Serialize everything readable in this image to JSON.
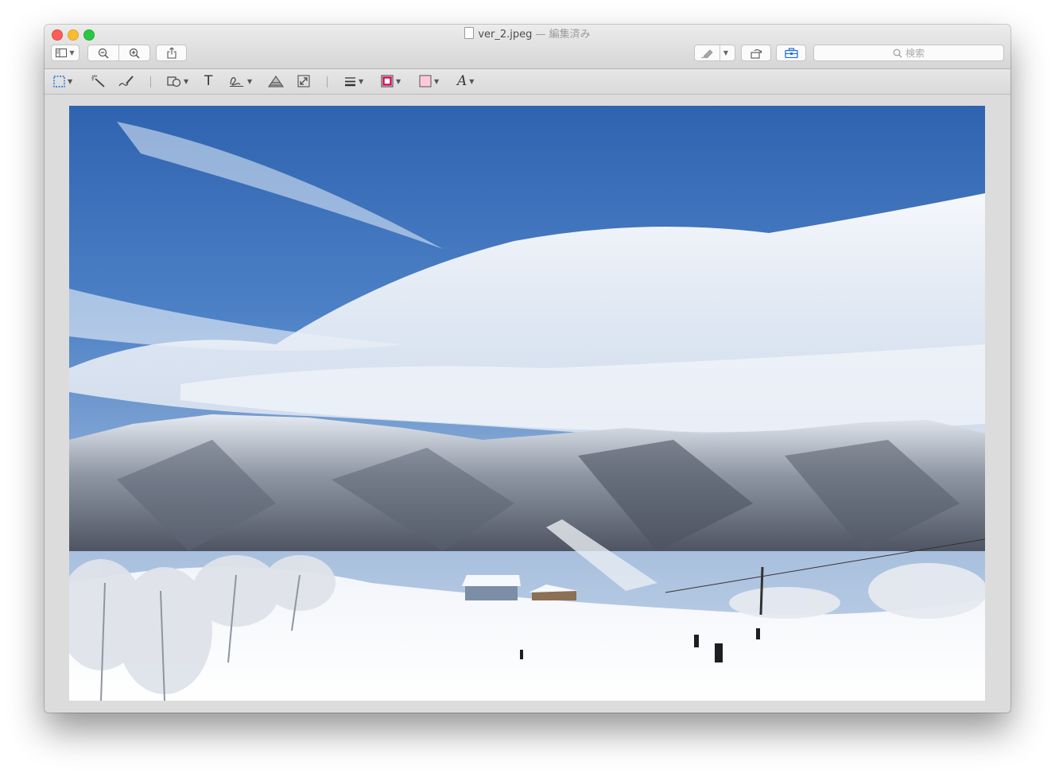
{
  "window": {
    "file_name": "ver_2.jpeg",
    "separator": "—",
    "edit_status": "編集済み"
  },
  "toolbar": {
    "sidebar_icon": "sidebar-icon",
    "zoom_out_icon": "zoom-out-icon",
    "zoom_in_icon": "zoom-in-icon",
    "share_icon": "share-icon",
    "highlight_icon": "highlighter-icon",
    "rotate_icon": "rotate-icon",
    "markup_icon": "toolbox-icon",
    "search_placeholder": "検索"
  },
  "markup_tools": [
    "rect-selection-icon",
    "instant-alpha-icon",
    "sketch-icon",
    "shapes-icon",
    "text-icon",
    "sign-icon",
    "adjust-color-icon",
    "adjust-size-icon",
    "shape-style-icon",
    "border-color-icon",
    "fill-color-icon",
    "text-style-icon"
  ],
  "markup": {
    "text_tool_glyph": "T",
    "text_style_glyph": "A"
  },
  "colors": {
    "close": "#fc5f57",
    "minimize": "#fdbc2e",
    "zoom": "#29c840",
    "border_color": "#d0105a",
    "fill_color": "#ffc8dc",
    "accent": "#1d6fe0"
  }
}
